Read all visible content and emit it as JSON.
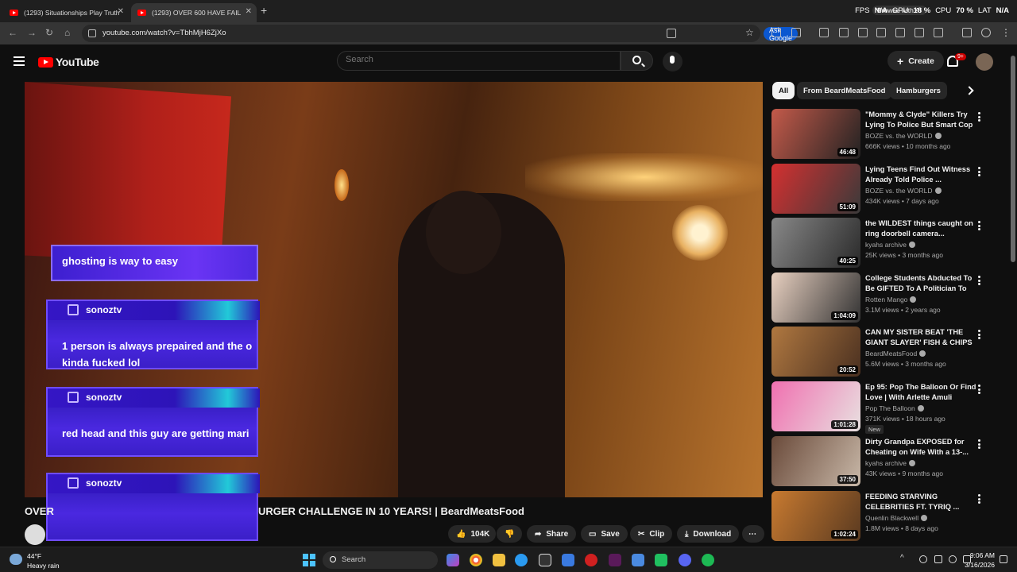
{
  "browser": {
    "tabs": [
      {
        "label": "(1293) Situationships Play Truth"
      },
      {
        "label": "(1293) OVER 600 HAVE FAIL"
      }
    ],
    "url": "youtube.com/watch?v=TbhMjH6ZjXo",
    "ask_google": "Ask Google",
    "agent_label": "Browse with AI"
  },
  "stats": {
    "fps_label": "FPS",
    "fps_value": "N/A",
    "gpu_label": "GPU",
    "gpu_value": "18 %",
    "cpu_label": "CPU",
    "cpu_value": "70 %",
    "lat_label": "LAT",
    "lat_value": "N/A"
  },
  "yt": {
    "logo": "YouTube",
    "search_placeholder": "Search",
    "create": "Create",
    "notif_badge": "9+"
  },
  "chat": {
    "msg1": "ghosting is way to easy",
    "cards": [
      {
        "user": "sonoztv",
        "text1": "1 person is always prepaired and the o",
        "text2": "kinda fucked lol"
      },
      {
        "user": "sonoztv",
        "text1": "red head and this guy are getting mari",
        "text2": ""
      },
      {
        "user": "sonoztv",
        "text1": "",
        "text2": ""
      }
    ]
  },
  "video": {
    "title_left": "OVER",
    "title_right": "URGER CHALLENGE IN 10 YEARS! | BeardMeatsFood",
    "likes": "104K",
    "share": "Share",
    "save": "Save",
    "clip": "Clip",
    "download": "Download"
  },
  "chips": [
    {
      "label": "All",
      "active": true
    },
    {
      "label": "From BeardMeatsFood"
    },
    {
      "label": "Hamburgers"
    }
  ],
  "recommendations": [
    {
      "title": "\"Mommy & Clyde\" Killers Try Lying To Police But Smart Cop ...",
      "channel": "BOZE vs. the WORLD",
      "meta": "666K views • 10 months ago",
      "duration": "46:48",
      "colors": [
        "#c45a4a",
        "#222"
      ]
    },
    {
      "title": "Lying Teens Find Out Witness Already Told Police ...",
      "channel": "BOZE vs. the WORLD",
      "meta": "434K views • 7 days ago",
      "duration": "51:09",
      "colors": [
        "#d43030",
        "#3a3a3a"
      ]
    },
    {
      "title": "the WILDEST things caught on ring doorbell camera...",
      "channel": "kyahs archive",
      "meta": "25K views • 3 months ago",
      "duration": "40:25",
      "colors": [
        "#888",
        "#2a2a2a"
      ]
    },
    {
      "title": "College Students Abducted To Be GIFTED To A Politician To B...",
      "channel": "Rotten Mango",
      "meta": "3.1M views • 2 years ago",
      "duration": "1:04:09",
      "colors": [
        "#e8d0c0",
        "#333"
      ]
    },
    {
      "title": "CAN MY SISTER BEAT 'THE GIANT SLAYER' FISH & CHIPS ...",
      "channel": "BeardMeatsFood",
      "meta": "5.6M views • 3 months ago",
      "duration": "20:52",
      "colors": [
        "#b07840",
        "#4a3020"
      ]
    },
    {
      "title": "Ep 95: Pop The Balloon Or Find Love | With Arlette Amuli",
      "channel": "Pop The Balloon",
      "meta": "371K views • 18 hours ago",
      "duration": "1:01:28",
      "badge": "New",
      "colors": [
        "#f070b0",
        "#e8e0e0"
      ]
    },
    {
      "title": "Dirty Grandpa EXPOSED for Cheating on Wife With a 13-...",
      "channel": "kyahs archive",
      "meta": "43K views • 9 months ago",
      "duration": "37:50",
      "colors": [
        "#6a4a3a",
        "#c8b8a8"
      ]
    },
    {
      "title": "FEEDING STARVING CELEBRITIES FT. TYRIQ ...",
      "channel": "Quenlin Blackwell",
      "meta": "1.8M views • 8 days ago",
      "duration": "1:02:24",
      "colors": [
        "#c87a30",
        "#5a3a20"
      ]
    }
  ],
  "taskbar": {
    "temp": "44°F",
    "condition": "Heavy rain",
    "search": "Search",
    "time": "9:06 AM",
    "date": "3/16/2026"
  }
}
